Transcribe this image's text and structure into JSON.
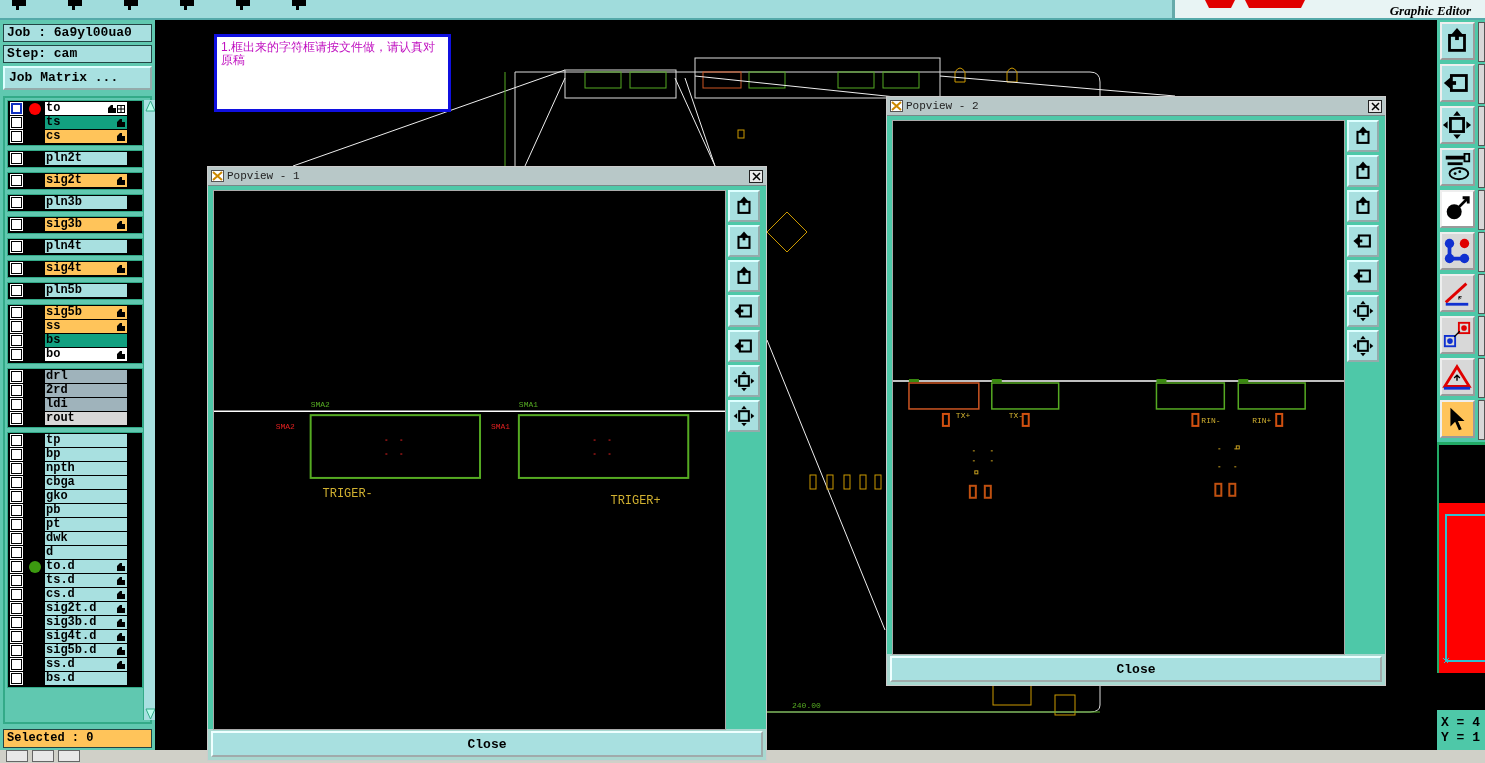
{
  "header": {
    "subtitle": "Graphic Editor"
  },
  "job": {
    "job_label": "Job : 6a9yl00ua0",
    "step_label": "Step: cam",
    "matrix_button": "Job Matrix ..."
  },
  "layer_groups": [
    {
      "layers": [
        {
          "name": "to",
          "kind": "silk",
          "hand": true,
          "focused": true,
          "checked": false,
          "color": "#ff0000"
        },
        {
          "name": "ts",
          "kind": "mask",
          "hand": true,
          "focused": false,
          "checked": false
        },
        {
          "name": "cs",
          "kind": "signal",
          "hand": true,
          "focused": false,
          "checked": false
        }
      ]
    },
    {
      "layers": [
        {
          "name": "pln2t",
          "kind": "doc",
          "hand": false,
          "focused": false,
          "checked": false
        }
      ]
    },
    {
      "layers": [
        {
          "name": "sig2t",
          "kind": "signal",
          "hand": true,
          "focused": false,
          "checked": false
        }
      ]
    },
    {
      "layers": [
        {
          "name": "pln3b",
          "kind": "doc",
          "hand": false,
          "focused": false,
          "checked": false
        }
      ]
    },
    {
      "layers": [
        {
          "name": "sig3b",
          "kind": "signal",
          "hand": true,
          "focused": false,
          "checked": false
        }
      ]
    },
    {
      "layers": [
        {
          "name": "pln4t",
          "kind": "doc",
          "hand": false,
          "focused": false,
          "checked": false
        }
      ]
    },
    {
      "layers": [
        {
          "name": "sig4t",
          "kind": "signal",
          "hand": true,
          "focused": false,
          "checked": false
        }
      ]
    },
    {
      "layers": [
        {
          "name": "pln5b",
          "kind": "doc",
          "hand": false,
          "focused": false,
          "checked": false
        }
      ]
    },
    {
      "layers": [
        {
          "name": "sig5b",
          "kind": "signal",
          "hand": true,
          "focused": false,
          "checked": false
        },
        {
          "name": "ss",
          "kind": "signal",
          "hand": true,
          "focused": false,
          "checked": false
        },
        {
          "name": "bs",
          "kind": "mask",
          "hand": false,
          "focused": false,
          "checked": false
        },
        {
          "name": "bo",
          "kind": "silk",
          "hand": true,
          "focused": false,
          "checked": false
        }
      ]
    },
    {
      "layers": [
        {
          "name": "drl",
          "kind": "drill",
          "hand": false,
          "focused": false,
          "checked": false
        },
        {
          "name": "2rd",
          "kind": "drill",
          "hand": false,
          "focused": false,
          "checked": false
        },
        {
          "name": "ldi",
          "kind": "drill",
          "hand": false,
          "focused": false,
          "checked": false
        },
        {
          "name": "rout",
          "kind": "rout",
          "hand": false,
          "focused": false,
          "checked": false
        }
      ]
    },
    {
      "layers": [
        {
          "name": "tp",
          "kind": "doc",
          "hand": false,
          "focused": false,
          "checked": false
        },
        {
          "name": "bp",
          "kind": "doc",
          "hand": false,
          "focused": false,
          "checked": false
        },
        {
          "name": "npth",
          "kind": "doc",
          "hand": false,
          "focused": false,
          "checked": false
        },
        {
          "name": "cbga",
          "kind": "doc",
          "hand": false,
          "focused": false,
          "checked": false
        },
        {
          "name": "gko",
          "kind": "doc",
          "hand": false,
          "focused": false,
          "checked": false
        },
        {
          "name": "pb",
          "kind": "doc",
          "hand": false,
          "focused": false,
          "checked": false
        },
        {
          "name": "pt",
          "kind": "doc",
          "hand": false,
          "focused": false,
          "checked": false
        },
        {
          "name": "dwk",
          "kind": "doc",
          "hand": false,
          "focused": false,
          "checked": false
        },
        {
          "name": "d",
          "kind": "doc",
          "hand": false,
          "focused": false,
          "checked": false
        },
        {
          "name": "to.d",
          "kind": "doc",
          "hand": true,
          "focused": false,
          "checked": false,
          "color": "#3c9a10"
        },
        {
          "name": "ts.d",
          "kind": "doc",
          "hand": true,
          "focused": false,
          "checked": false
        },
        {
          "name": "cs.d",
          "kind": "doc",
          "hand": true,
          "focused": false,
          "checked": false
        },
        {
          "name": "sig2t.d",
          "kind": "doc",
          "hand": true,
          "focused": false,
          "checked": false
        },
        {
          "name": "sig3b.d",
          "kind": "doc",
          "hand": true,
          "focused": false,
          "checked": false
        },
        {
          "name": "sig4t.d",
          "kind": "doc",
          "hand": true,
          "focused": false,
          "checked": false
        },
        {
          "name": "sig5b.d",
          "kind": "doc",
          "hand": true,
          "focused": false,
          "checked": false
        },
        {
          "name": "ss.d",
          "kind": "doc",
          "hand": true,
          "focused": false,
          "checked": false
        },
        {
          "name": "bs.d",
          "kind": "doc",
          "hand": false,
          "focused": false,
          "checked": false
        }
      ]
    }
  ],
  "selected_count": "Selected : 0",
  "note": "1.框出来的字符框请按文件做，请认真对原稿",
  "canvas": {
    "dimension": "240.00"
  },
  "popviews": [
    {
      "title": "Popview - 1",
      "close": "Close",
      "connectors": [
        {
          "top_label": "SMA2",
          "side_label": "SMA2",
          "caption": "TRIGER-"
        },
        {
          "top_label": "SMA1",
          "side_label": "SMA1",
          "caption": "TRIGER+"
        }
      ]
    },
    {
      "title": "Popview - 2",
      "close": "Close",
      "connectors": [
        {
          "caption": "TX+"
        },
        {
          "caption": "TX-"
        },
        {
          "caption": "RIN-"
        },
        {
          "caption": "RIN+"
        }
      ]
    }
  ],
  "tools": [
    {
      "kind": "frame-up",
      "selected": false
    },
    {
      "kind": "frame-left",
      "selected": false
    },
    {
      "kind": "fit",
      "selected": false
    },
    {
      "kind": "palette",
      "selected": false
    },
    {
      "kind": "circle-arrow",
      "selected": false
    },
    {
      "kind": "nodes",
      "selected": false
    },
    {
      "kind": "angle",
      "selected": false
    },
    {
      "kind": "squares",
      "selected": false
    },
    {
      "kind": "triangle",
      "selected": false
    },
    {
      "kind": "pointer",
      "selected": true
    }
  ],
  "coordinates": {
    "x": "X = 4",
    "y": "Y = 1"
  }
}
